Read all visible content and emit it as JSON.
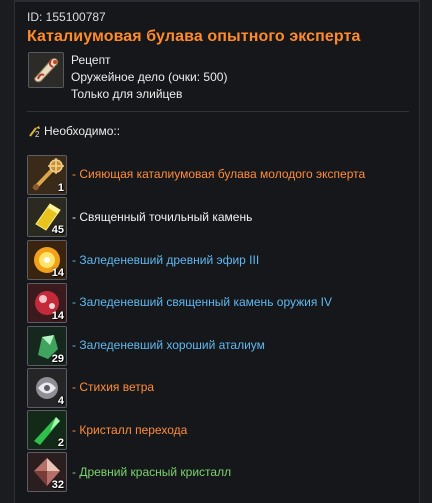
{
  "item": {
    "id_text": "ID: 155100787",
    "title": "Каталиумовая булава опытного эксперта",
    "recipe_label": "Рецепт",
    "profession": "Оружейное дело (очки: 500)",
    "restriction": "Только для элийцев"
  },
  "requirements": {
    "header": "Необходимо::",
    "materials": [
      {
        "label": "- Сияющая каталиумовая булава молодого эксперта",
        "count": "1",
        "icon": "mace-icon",
        "color": "#ff8d3a"
      },
      {
        "label": "- Священный точильный камень",
        "count": "45",
        "icon": "whetstone-icon",
        "color": "#f0f0f0"
      },
      {
        "label": "- Заледеневший древний эфир III",
        "count": "14",
        "icon": "ether-icon",
        "color": "#5fb8ee"
      },
      {
        "label": "- Заледеневший священный камень оружия IV",
        "count": "14",
        "icon": "weapon-stone-icon",
        "color": "#5fb8ee"
      },
      {
        "label": "- Заледеневший хороший аталиум",
        "count": "29",
        "icon": "atalium-icon",
        "color": "#5fb8ee"
      },
      {
        "label": "- Стихия ветра",
        "count": "4",
        "icon": "wind-element-icon",
        "color": "#ff8d3a"
      },
      {
        "label": "- Кристалл перехода",
        "count": "2",
        "icon": "transition-crystal-icon",
        "color": "#ff8d3a"
      },
      {
        "label": "- Древний красный кристалл",
        "count": "32",
        "icon": "red-crystal-icon",
        "color": "#7bd36b"
      }
    ]
  }
}
